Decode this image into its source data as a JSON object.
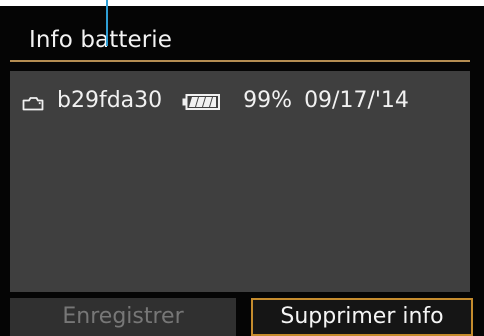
{
  "screen": {
    "title": "Info batterie",
    "battery_entry": {
      "id": "b29fda30",
      "percent": "99%",
      "date": "09/17/'14",
      "icons": {
        "camera": "camera-icon",
        "battery": "battery-icon"
      }
    },
    "buttons": {
      "left": "Enregistrer",
      "right": "Supprimer info"
    },
    "colors": {
      "background": "#050505",
      "panel": "#3f3f3f",
      "accent": "#b58d52",
      "selected_border": "#c48b2d",
      "callout": "#2e9fd6"
    }
  }
}
